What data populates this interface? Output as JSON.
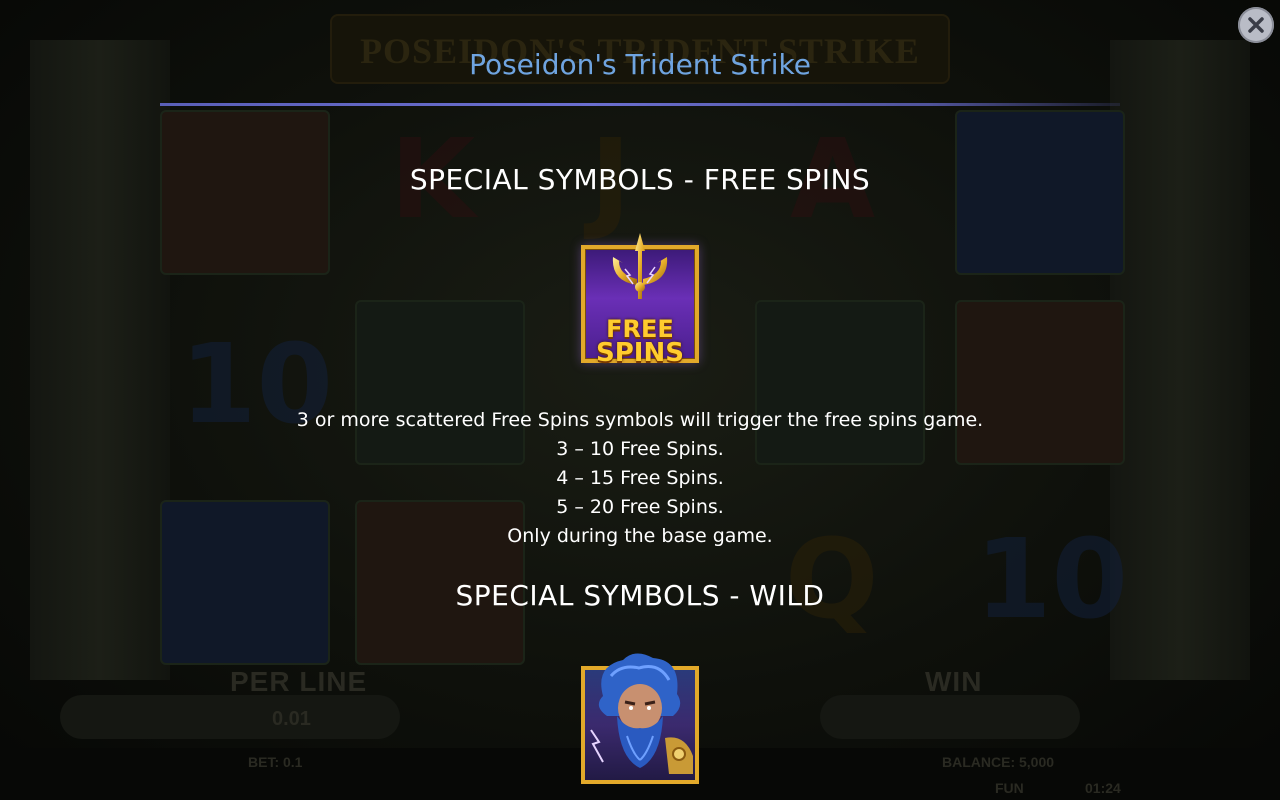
{
  "modal": {
    "title": "Poseidon's Trident Strike",
    "close_icon": "close-icon"
  },
  "sections": [
    {
      "heading": "SPECIAL SYMBOLS - FREE SPINS",
      "symbol": {
        "icon": "free-spins-trident-icon",
        "lines": [
          "FREE",
          "SPINS"
        ]
      },
      "description": [
        "3 or more scattered Free Spins symbols will trigger the free spins game.",
        "3 – 10 Free Spins.",
        "4 – 15 Free Spins.",
        "5 – 20 Free Spins.",
        "Only during the base game."
      ]
    },
    {
      "heading": "SPECIAL SYMBOLS - WILD",
      "symbol": {
        "icon": "poseidon-wild-icon"
      }
    }
  ],
  "colors": {
    "title": "#6fa4e0",
    "divider": "#5a5fb8",
    "symbol_frame": "#e2a92a",
    "free_spins_text": "#ffcc2e"
  }
}
